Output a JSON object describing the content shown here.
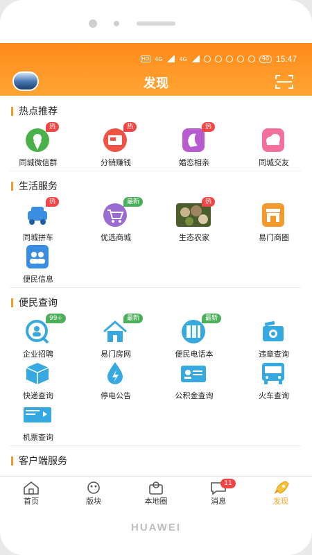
{
  "status": {
    "net1": "HD",
    "net2": "4G",
    "net3": "4G",
    "battery": "90",
    "time": "15:47"
  },
  "header": {
    "title": "发现"
  },
  "sections": [
    {
      "title": "热点推荐",
      "items": [
        {
          "label": "同城微信群",
          "badge": "热",
          "icon": "map-pin-icon",
          "color": "#4ab04a"
        },
        {
          "label": "分销赚钱",
          "badge": "热",
          "icon": "wallet-icon",
          "color": "#ef5346"
        },
        {
          "label": "婚恋相亲",
          "badge": "热",
          "icon": "woman-icon",
          "color": "#b85ad0"
        },
        {
          "label": "同城交友",
          "badge": "",
          "icon": "cloud-icon",
          "color": "#f3709a"
        }
      ]
    },
    {
      "title": "生活服务",
      "items": [
        {
          "label": "同城拼车",
          "badge": "热",
          "icon": "car-icon",
          "color": "#3a8de0"
        },
        {
          "label": "优选商城",
          "badge": "最新",
          "icon": "cart-icon",
          "color": "#9a6bd3"
        },
        {
          "label": "生态农家",
          "badge": "热",
          "icon": "farm-photo-icon",
          "color": "#6b8a45"
        },
        {
          "label": "易门商圈",
          "badge": "",
          "icon": "shop-icon",
          "color": "#f39a2c"
        },
        {
          "label": "便民信息",
          "badge": "",
          "icon": "people-icon",
          "color": "#3a8de0"
        }
      ]
    },
    {
      "title": "便民查询",
      "items": [
        {
          "label": "企业招聘",
          "badge": "99+",
          "icon": "search-person-icon",
          "color": "#36a9e1"
        },
        {
          "label": "易门房网",
          "badge": "最新",
          "icon": "house-icon",
          "color": "#36a9e1"
        },
        {
          "label": "便民电话本",
          "badge": "最新",
          "icon": "phonebook-icon",
          "color": "#36a9e1"
        },
        {
          "label": "违章查询",
          "badge": "",
          "icon": "camera-icon",
          "color": "#36a9e1"
        },
        {
          "label": "快递查询",
          "badge": "",
          "icon": "package-icon",
          "color": "#36a9e1"
        },
        {
          "label": "停电公告",
          "badge": "",
          "icon": "power-drop-icon",
          "color": "#36a9e1"
        },
        {
          "label": "公积金查询",
          "badge": "",
          "icon": "id-card-icon",
          "color": "#36a9e1"
        },
        {
          "label": "火车查询",
          "badge": "",
          "icon": "bus-icon",
          "color": "#36a9e1"
        },
        {
          "label": "机票查询",
          "badge": "",
          "icon": "ticket-icon",
          "color": "#36a9e1"
        }
      ]
    },
    {
      "title": "客户端服务",
      "items": []
    }
  ],
  "tabs": [
    {
      "label": "首页",
      "icon": "home-icon"
    },
    {
      "label": "版块",
      "icon": "grid-icon"
    },
    {
      "label": "本地圈",
      "icon": "local-circle-icon"
    },
    {
      "label": "消息",
      "icon": "message-icon",
      "badge": "11"
    },
    {
      "label": "发现",
      "icon": "rocket-icon",
      "active": true
    }
  ],
  "brand": "HUAWEI",
  "colors": {
    "header_start": "#ff8a19",
    "header_end": "#ffa534",
    "accent": "#f3a521",
    "badge_hot": "#f24545",
    "badge_new": "#4cb05a"
  }
}
